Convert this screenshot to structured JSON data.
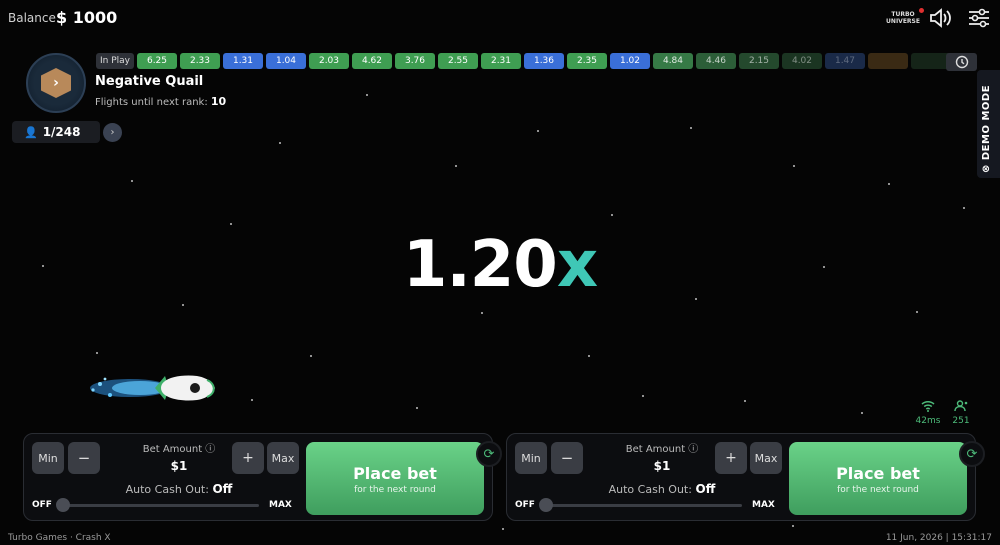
{
  "header": {
    "balance_label": "Balance:",
    "balance_value": "$ 1000",
    "icons": [
      "turbo-universe-icon",
      "sound-icon",
      "settings-icon"
    ]
  },
  "player": {
    "name": "Negative Quail",
    "flights_label": "Flights until next rank:",
    "flights_value": "10",
    "players_count": "1/248"
  },
  "history": {
    "in_play_label": "In Play",
    "items": [
      {
        "value": "6.25",
        "color": "#3f9e52"
      },
      {
        "value": "2.33",
        "color": "#3f9e52"
      },
      {
        "value": "1.31",
        "color": "#3a6fd8"
      },
      {
        "value": "1.04",
        "color": "#3a6fd8"
      },
      {
        "value": "2.03",
        "color": "#3f9e52"
      },
      {
        "value": "4.62",
        "color": "#3f9e52"
      },
      {
        "value": "3.76",
        "color": "#3f9e52"
      },
      {
        "value": "2.55",
        "color": "#3f9e52"
      },
      {
        "value": "2.31",
        "color": "#3f9e52"
      },
      {
        "value": "1.36",
        "color": "#3a6fd8"
      },
      {
        "value": "2.35",
        "color": "#3f9e52"
      },
      {
        "value": "1.02",
        "color": "#3a6fd8"
      },
      {
        "value": "4.84",
        "color": "#367a46"
      },
      {
        "value": "4.46",
        "color": "#2c5e38"
      },
      {
        "value": "2.15",
        "color": "#24492d"
      },
      {
        "value": "4.02",
        "color": "#1b3522"
      },
      {
        "value": "1.47",
        "color": "#1a2a48"
      },
      {
        "value": "",
        "color": "#3a2a14"
      },
      {
        "value": "",
        "color": "#152418"
      }
    ]
  },
  "demo_mode_label": "DEMO MODE",
  "multiplier": {
    "number": "1.20",
    "suffix": "x"
  },
  "network": {
    "ping": "42ms",
    "online": "251"
  },
  "bet_panels": [
    {
      "min_label": "Min",
      "minus_label": "−",
      "plus_label": "+",
      "max_label": "Max",
      "bet_amount_label": "Bet Amount ⓘ",
      "bet_amount_value": "$1",
      "auto_cashout_label": "Auto Cash Out:",
      "auto_cashout_value": "Off",
      "slider_off": "OFF",
      "slider_max": "MAX",
      "place_bet_label": "Place bet",
      "place_bet_sub": "for the next round"
    },
    {
      "min_label": "Min",
      "minus_label": "−",
      "plus_label": "+",
      "max_label": "Max",
      "bet_amount_label": "Bet Amount ⓘ",
      "bet_amount_value": "$1",
      "auto_cashout_label": "Auto Cash Out:",
      "auto_cashout_value": "Off",
      "slider_off": "OFF",
      "slider_max": "MAX",
      "place_bet_label": "Place bet",
      "place_bet_sub": "for the next round"
    }
  ],
  "footer": {
    "left": "Turbo Games · Crash X",
    "right": "11 Jun, 2026 | 15:31:17"
  }
}
